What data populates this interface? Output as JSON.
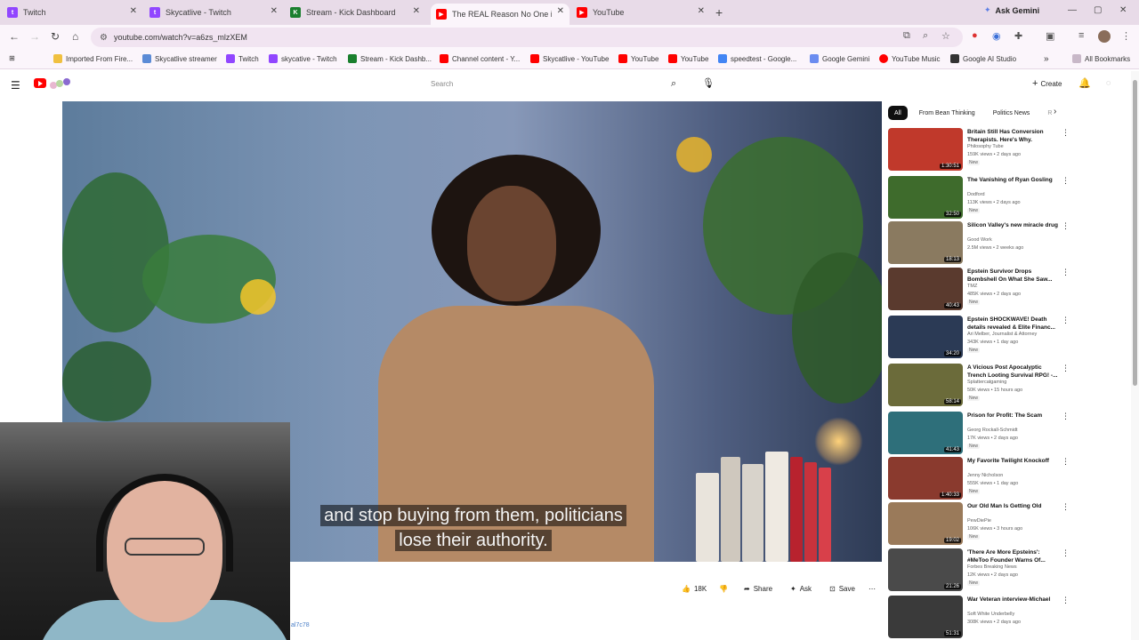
{
  "browser": {
    "tabs": [
      {
        "label": "Twitch",
        "favicon_color": "#9146ff",
        "active": false
      },
      {
        "label": "Skycatlive - Twitch",
        "favicon_color": "#9146ff",
        "active": false
      },
      {
        "label": "Stream - Kick Dashboard",
        "favicon_color": "#1a7f2e",
        "active": false
      },
      {
        "label": "The REAL Reason No One is Sh",
        "favicon_color": "#ff0000",
        "active": true
      },
      {
        "label": "YouTube",
        "favicon_color": "#ff0000",
        "active": false
      }
    ],
    "ask_gemini": "Ask Gemini",
    "url": "youtube.com/watch?v=a6zs_mlzXEM",
    "bookmarks": [
      {
        "label": "Imported From Fire...",
        "color": "#f0c040"
      },
      {
        "label": "Skycatlive streamer",
        "color": "#5b8bd6"
      },
      {
        "label": "Twitch",
        "color": "#9146ff"
      },
      {
        "label": "skycative - Twitch",
        "color": "#9146ff"
      },
      {
        "label": "Stream - Kick Dashb...",
        "color": "#1a7f2e"
      },
      {
        "label": "Channel content - Y...",
        "color": "#ff0000"
      },
      {
        "label": "Skycatlive - YouTube",
        "color": "#ff0000"
      },
      {
        "label": "YouTube",
        "color": "#ff0000"
      },
      {
        "label": "YouTube",
        "color": "#ff0000"
      },
      {
        "label": "speedtest - Google...",
        "color": "#4285f4"
      },
      {
        "label": "Google Gemini",
        "color": "#6b8cf0"
      },
      {
        "label": "YouTube Music",
        "color": "#ff0000"
      },
      {
        "label": "Google AI Studio",
        "color": "#333333"
      }
    ],
    "all_bookmarks": "All Bookmarks"
  },
  "youtube": {
    "search_placeholder": "Search",
    "create_label": "Create"
  },
  "player": {
    "caption_line1": "and stop buying from them, politicians",
    "caption_line2": "lose their authority."
  },
  "actions": {
    "likes": "18K",
    "share": "Share",
    "ask": "Ask",
    "save": "Save"
  },
  "description_stub": "al7c78",
  "chips": [
    "All",
    "From Bean Thinking",
    "Politics News",
    "R"
  ],
  "recommendations": [
    {
      "title": "Britain Still Has Conversion Therapists. Here's Why.",
      "channel": "Philosophy Tube",
      "meta": "159K views • 2 days ago",
      "badge": "New",
      "duration": "1:30:51",
      "thumb_color": "#c0392b"
    },
    {
      "title": "The Vanishing of Ryan Gosling",
      "channel": "Dodford",
      "meta": "113K views • 2 days ago",
      "badge": "New",
      "duration": "32:50",
      "thumb_color": "#3e6b2c"
    },
    {
      "title": "Silicon Valley's new miracle drug",
      "channel": "Good Work",
      "meta": "2.5M views • 2 weeks ago",
      "badge": "",
      "duration": "18:13",
      "thumb_color": "#8a7a60"
    },
    {
      "title": "Epstein Survivor Drops Bombshell On What She Saw...",
      "channel": "TMZ",
      "meta": "485K views • 2 days ago",
      "badge": "New",
      "duration": "40:43",
      "thumb_color": "#5a3a2e"
    },
    {
      "title": "Epstein SHOCKWAVE! Death details revealed & Elite Financ...",
      "channel": "Ari Melber, Journalist & Attorney",
      "meta": "343K views • 1 day ago",
      "badge": "New",
      "duration": "34:20",
      "thumb_color": "#2b3a55"
    },
    {
      "title": "A Vicious Post Apocalyptic Trench Looting Survival RPG! -...",
      "channel": "Splattercatgaming",
      "meta": "50K views • 15 hours ago",
      "badge": "New",
      "duration": "58:14",
      "thumb_color": "#6b6b3a"
    },
    {
      "title": "Prison for Profit: The Scam",
      "channel": "Georg Rockall-Schmidt",
      "meta": "17K views • 2 days ago",
      "badge": "New",
      "duration": "41:43",
      "thumb_color": "#2e6f7a"
    },
    {
      "title": "My Favorite Twilight Knockoff",
      "channel": "Jenny Nicholson",
      "meta": "555K views • 1 day ago",
      "badge": "New",
      "duration": "1:40:33",
      "thumb_color": "#8a3a2e"
    },
    {
      "title": "Our Old Man Is Getting Old",
      "channel": "PewDiePie",
      "meta": "106K views • 3 hours ago",
      "badge": "New",
      "duration": "19:02",
      "thumb_color": "#9a7a5a"
    },
    {
      "title": "'There Are More Epsteins': #MeToo Founder Warns Of...",
      "channel": "Forbes Breaking News",
      "meta": "12K views • 2 days ago",
      "badge": "New",
      "duration": "21:26",
      "thumb_color": "#4a4a4a"
    },
    {
      "title": "War Veteran interview-Michael",
      "channel": "Soft White Underbelly",
      "meta": "308K views • 2 days ago",
      "badge": "",
      "duration": "51:31",
      "thumb_color": "#3a3a3a"
    }
  ]
}
